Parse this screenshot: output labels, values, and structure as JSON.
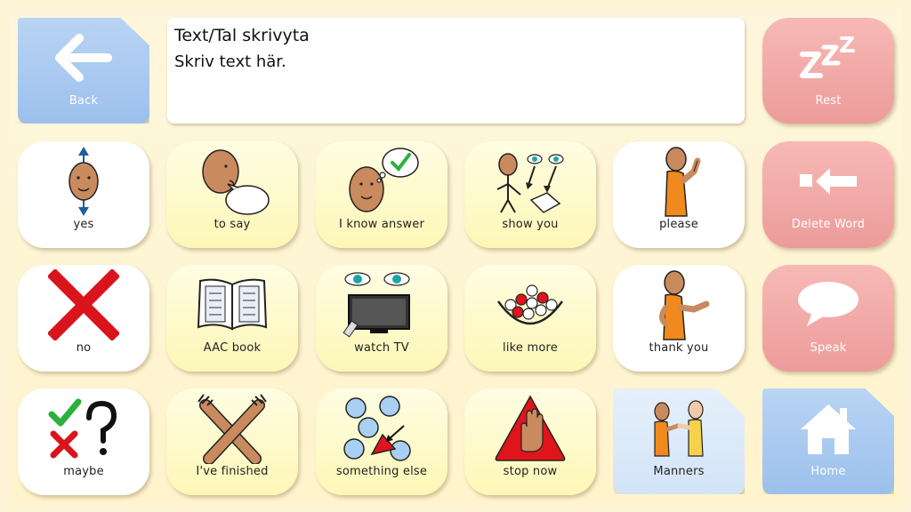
{
  "text_area": {
    "title": "Text/Tal skrivyta",
    "placeholder": "Skriv text här."
  },
  "grid": {
    "back": "Back",
    "rest": "Rest",
    "delete_word": "Delete Word",
    "speak": "Speak",
    "home": "Home",
    "yes": "yes",
    "to_say": "to say",
    "i_know_answer": "I know answer",
    "show_you": "show you",
    "please": "please",
    "no": "no",
    "aac_book": "AAC book",
    "watch_tv": "watch TV",
    "like_more": "like more",
    "thank_you": "thank you",
    "maybe": "maybe",
    "ive_finished": "I've finished",
    "something_else": "something else",
    "stop_now": "stop now",
    "manners": "Manners"
  },
  "colors": {
    "background": "#fdf3d6",
    "red_cell": "#ec9c9a",
    "blue_cell": "#9cc0ec",
    "yellow_cell": "#fdf7b6",
    "cross_red": "#d9141d",
    "check_green": "#2bb13c"
  }
}
